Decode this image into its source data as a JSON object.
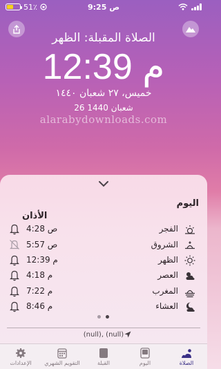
{
  "status_bar": {
    "battery_percent": "51٪",
    "time": "9:25 ص",
    "battery_level": 0.51
  },
  "header": {
    "next_prayer": "الصلاة المقبلة: الظهر",
    "countdown": "12:39 م",
    "date_hijri": "خميس، ٢٧ شعبان ١٤٤٠",
    "date_alt": "26 شعبان 1440",
    "watermark": "alarabydownloads.com"
  },
  "card": {
    "title_today": "اليوم",
    "title_athan": "الأذان",
    "prayers": [
      {
        "name": "الفجر",
        "time": "4:28 ص",
        "icon": "sunrise-icon",
        "alert": "on"
      },
      {
        "name": "الشروق",
        "time": "5:57 ص",
        "icon": "sunrise-low-icon",
        "alert": "off"
      },
      {
        "name": "الظهر",
        "time": "12:39 م",
        "icon": "sun-icon",
        "alert": "on"
      },
      {
        "name": "العصر",
        "time": "4:18 م",
        "icon": "sun-cloud-icon",
        "alert": "on"
      },
      {
        "name": "المغرب",
        "time": "7:22 م",
        "icon": "sunset-icon",
        "alert": "on"
      },
      {
        "name": "العشاء",
        "time": "8:46 م",
        "icon": "moon-cloud-icon",
        "alert": "on"
      }
    ],
    "location": "(null), (null)"
  },
  "tabs": [
    {
      "label": "الإعدادات",
      "icon": "gear-icon",
      "active": false
    },
    {
      "label": "التقويم الشهري",
      "icon": "calendar-icon",
      "active": false
    },
    {
      "label": "القبلة",
      "icon": "qibla-icon",
      "active": false
    },
    {
      "label": "اليوم",
      "icon": "today-icon",
      "active": false
    },
    {
      "label": "الصلاة",
      "icon": "prayer-icon",
      "active": true
    }
  ],
  "colors": {
    "accent": "#3a2f86",
    "battery": "#f4d21f",
    "gradient_top": "#9b5fc0",
    "gradient_bottom": "#f6dde8"
  }
}
